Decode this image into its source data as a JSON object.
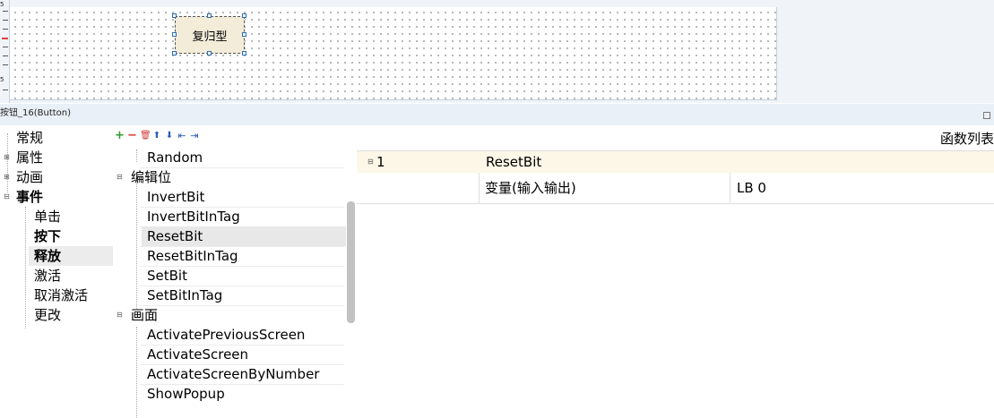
{
  "canvas": {
    "button_label": "复归型",
    "ruler_labels": [
      "5",
      "5"
    ]
  },
  "titlebar": {
    "title": "按钮_16(Button)"
  },
  "categories": {
    "items": [
      {
        "label": "常规",
        "expandable": false,
        "bold": false
      },
      {
        "label": "属性",
        "expandable": true,
        "bold": false
      },
      {
        "label": "动画",
        "expandable": true,
        "bold": false
      },
      {
        "label": "事件",
        "expandable": true,
        "bold": true
      },
      {
        "label": "单击",
        "expandable": false,
        "bold": false
      },
      {
        "label": "按下",
        "expandable": false,
        "bold": true
      },
      {
        "label": "释放",
        "expandable": false,
        "bold": true,
        "selected": true
      },
      {
        "label": "激活",
        "expandable": false,
        "bold": false
      },
      {
        "label": "取消激活",
        "expandable": false,
        "bold": false
      },
      {
        "label": "更改",
        "expandable": false,
        "bold": false
      }
    ]
  },
  "toolbar": {
    "add": "+",
    "remove": "−",
    "delete": "🗑",
    "up": "⬆",
    "down": "⬇",
    "indent": "⇤",
    "outdent": "⇥"
  },
  "functions": {
    "items": [
      {
        "label": "Random",
        "group": false
      },
      {
        "label": "编辑位",
        "group": true
      },
      {
        "label": "InvertBit",
        "group": false
      },
      {
        "label": "InvertBitInTag",
        "group": false
      },
      {
        "label": "ResetBit",
        "group": false,
        "selected": true
      },
      {
        "label": "ResetBitInTag",
        "group": false
      },
      {
        "label": "SetBit",
        "group": false
      },
      {
        "label": "SetBitInTag",
        "group": false
      },
      {
        "label": "画面",
        "group": true
      },
      {
        "label": "ActivatePreviousScreen",
        "group": false
      },
      {
        "label": "ActivateScreen",
        "group": false
      },
      {
        "label": "ActivateScreenByNumber",
        "group": false
      },
      {
        "label": "ShowPopup",
        "group": false
      }
    ]
  },
  "grid": {
    "title": "函数列表",
    "row1_index": "1",
    "row1_function": "ResetBit",
    "row2_param": "变量(输入输出)",
    "row2_value": "LB 0"
  },
  "colors": {
    "canvas_bg": "#f0f4f9",
    "button_fill": "#f2ecd9",
    "handle_border": "#2a6db5",
    "row_highlight": "#fdf7e8",
    "toolbar_green": "#2e9b2e",
    "toolbar_red": "#d23b3b",
    "toolbar_blue": "#2b5fb0"
  }
}
